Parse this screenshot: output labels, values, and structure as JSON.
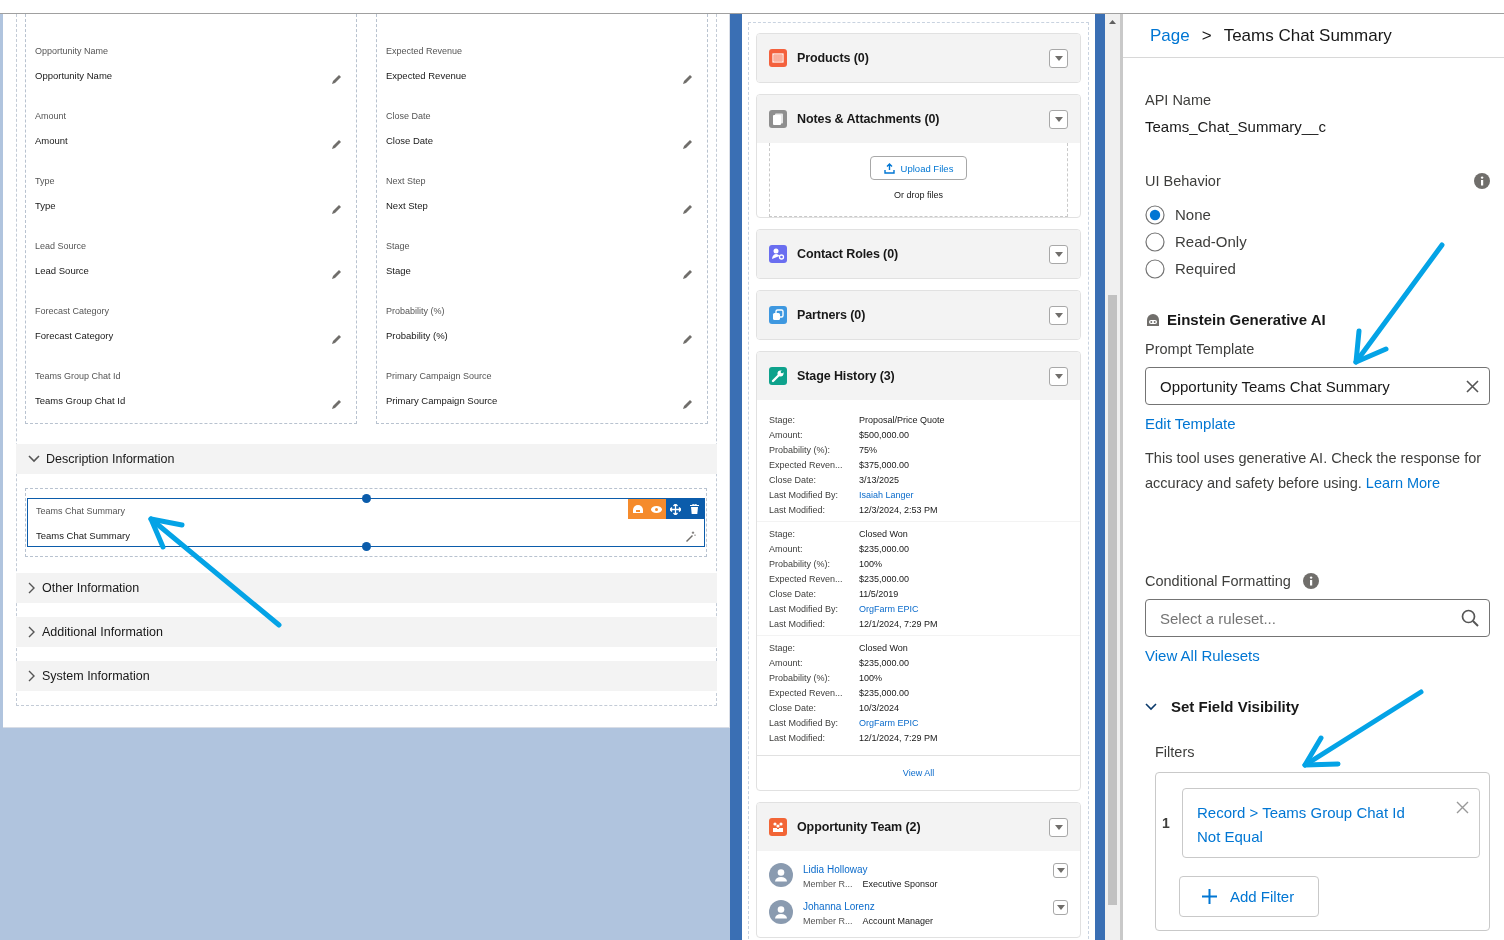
{
  "canvas": {
    "field_columns": [
      [
        {
          "label": "Opportunity Name",
          "value": "Opportunity Name"
        },
        {
          "label": "Amount",
          "value": "Amount"
        },
        {
          "label": "Type",
          "value": "Type"
        },
        {
          "label": "Lead Source",
          "value": "Lead Source"
        },
        {
          "label": "Forecast Category",
          "value": "Forecast Category"
        },
        {
          "label": "Teams Group Chat Id",
          "value": "Teams Group Chat Id"
        }
      ],
      [
        {
          "label": "Expected Revenue",
          "value": "Expected Revenue"
        },
        {
          "label": "Close Date",
          "value": "Close Date"
        },
        {
          "label": "Next Step",
          "value": "Next Step"
        },
        {
          "label": "Stage",
          "value": "Stage"
        },
        {
          "label": "Probability (%)",
          "value": "Probability (%)"
        },
        {
          "label": "Primary Campaign Source",
          "value": "Primary Campaign Source"
        }
      ]
    ],
    "sections": [
      {
        "title": "Description Information",
        "expanded": true,
        "fields": [
          {
            "label": "Teams Chat Summary",
            "value": "Teams Chat Summary",
            "selected": true
          }
        ]
      },
      {
        "title": "Other Information",
        "expanded": false
      },
      {
        "title": "Additional Information",
        "expanded": false
      },
      {
        "title": "System Information",
        "expanded": false
      }
    ]
  },
  "related_lists": [
    {
      "kind": "products",
      "color": "#f4613d",
      "title": "Products (0)"
    },
    {
      "kind": "notes",
      "color": "#8e8e8e",
      "title": "Notes & Attachments (0)",
      "upload_button": "Upload Files",
      "drop_hint": "Or drop files"
    },
    {
      "kind": "contacts",
      "color": "#6a6ef0",
      "title": "Contact Roles (0)"
    },
    {
      "kind": "partners",
      "color": "#3e98e0",
      "title": "Partners (0)"
    },
    {
      "kind": "history",
      "color": "#0ea28c",
      "title": "Stage History (3)",
      "records": [
        {
          "rows": [
            {
              "label": "Stage:",
              "value": "Proposal/Price Quote",
              "link": false
            },
            {
              "label": "Amount:",
              "value": "$500,000.00",
              "link": false
            },
            {
              "label": "Probability (%):",
              "value": "75%",
              "link": false
            },
            {
              "label": "Expected Reven...",
              "value": "$375,000.00",
              "link": false
            },
            {
              "label": "Close Date:",
              "value": "3/13/2025",
              "link": false
            },
            {
              "label": "Last Modified By:",
              "value": "Isaiah Langer",
              "link": true
            },
            {
              "label": "Last Modified:",
              "value": "12/3/2024, 2:53 PM",
              "link": false
            }
          ]
        },
        {
          "rows": [
            {
              "label": "Stage:",
              "value": "Closed Won",
              "link": false
            },
            {
              "label": "Amount:",
              "value": "$235,000.00",
              "link": false
            },
            {
              "label": "Probability (%):",
              "value": "100%",
              "link": false
            },
            {
              "label": "Expected Reven...",
              "value": "$235,000.00",
              "link": false
            },
            {
              "label": "Close Date:",
              "value": "11/5/2019",
              "link": false
            },
            {
              "label": "Last Modified By:",
              "value": "OrgFarm EPIC",
              "link": true
            },
            {
              "label": "Last Modified:",
              "value": "12/1/2024, 7:29 PM",
              "link": false
            }
          ]
        },
        {
          "rows": [
            {
              "label": "Stage:",
              "value": "Closed Won",
              "link": false
            },
            {
              "label": "Amount:",
              "value": "$235,000.00",
              "link": false
            },
            {
              "label": "Probability (%):",
              "value": "100%",
              "link": false
            },
            {
              "label": "Expected Reven...",
              "value": "$235,000.00",
              "link": false
            },
            {
              "label": "Close Date:",
              "value": "10/3/2024",
              "link": false
            },
            {
              "label": "Last Modified By:",
              "value": "OrgFarm EPIC",
              "link": true
            },
            {
              "label": "Last Modified:",
              "value": "12/1/2024, 7:29 PM",
              "link": false
            }
          ]
        }
      ],
      "footer": "View All"
    },
    {
      "kind": "team",
      "color": "#f26536",
      "title": "Opportunity Team (2)",
      "members": [
        {
          "name": "Lidia Holloway",
          "role_label": "Member R...",
          "role": "Executive Sponsor"
        },
        {
          "name": "Johanna Lorenz",
          "role_label": "Member R...",
          "role": "Account Manager"
        }
      ]
    }
  ],
  "properties": {
    "breadcrumb": {
      "parent": "Page",
      "separator": ">",
      "current": "Teams Chat Summary"
    },
    "api_name_label": "API Name",
    "api_name": "Teams_Chat_Summary__c",
    "ui_behavior": {
      "label": "UI Behavior",
      "options": [
        {
          "label": "None",
          "selected": true
        },
        {
          "label": "Read-Only",
          "selected": false
        },
        {
          "label": "Required",
          "selected": false
        }
      ]
    },
    "einstein": {
      "title": "Einstein Generative AI",
      "prompt_label": "Prompt Template",
      "prompt_value": "Opportunity Teams Chat Summary",
      "edit_link": "Edit Template",
      "disclaimer": "This tool uses generative AI. Check the response for accuracy and safety before using.",
      "learn_more": "Learn More"
    },
    "conditional": {
      "label": "Conditional Formatting",
      "placeholder": "Select a ruleset...",
      "link": "View All Rulesets"
    },
    "visibility": {
      "title": "Set Field Visibility",
      "expanded": true,
      "filters_label": "Filters",
      "filters": [
        {
          "number": "1",
          "field": "Record > Teams Group Chat Id",
          "operator": "Not Equal"
        }
      ],
      "add_button": "Add Filter"
    }
  }
}
